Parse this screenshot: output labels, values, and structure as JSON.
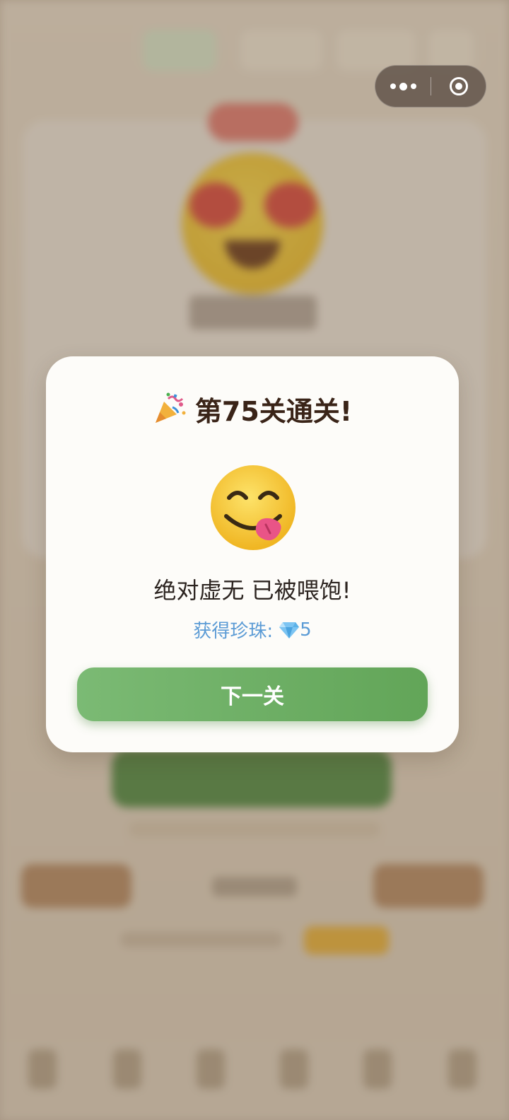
{
  "modal": {
    "title": "第75关通关!",
    "title_icon": "party-popper-icon",
    "result_icon": "savoring-food-face-icon",
    "message": "绝对虚无 已被喂饱!",
    "reward_label": "获得珍珠:",
    "reward_icon": "gem-icon",
    "reward_value": "5",
    "next_button_label": "下一关"
  },
  "capsule": {
    "more_icon": "more-dots-icon",
    "close_icon": "close-mini-program-icon"
  },
  "colors": {
    "modal_bg": "#fdfcf9",
    "title_text": "#3a2418",
    "reward_text": "#5b9bd5",
    "button_start": "#7bba74",
    "button_end": "#62a558"
  }
}
